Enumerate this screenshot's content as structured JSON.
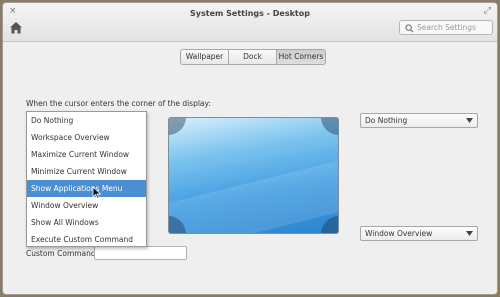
{
  "window": {
    "title": "System Settings - Desktop",
    "close_glyph": "×",
    "maximize_glyph": "⤢"
  },
  "header": {
    "home_icon": "home-icon",
    "search": {
      "placeholder": "Search Settings",
      "value": "",
      "icon": "search-icon"
    }
  },
  "tabs": [
    {
      "label": "Wallpaper",
      "active": false
    },
    {
      "label": "Dock",
      "active": false
    },
    {
      "label": "Hot Corners",
      "active": true
    }
  ],
  "hot_corners": {
    "instruction": "When the cursor enters the corner of the display:",
    "menu_items": [
      "Do Nothing",
      "Workspace Overview",
      "Maximize Current Window",
      "Minimize Current Window",
      "Show Applications Menu",
      "Window Overview",
      "Show All Windows",
      "Execute Custom Command"
    ],
    "selected_index": 4,
    "top_right_value": "Do Nothing",
    "bottom_right_value": "Window Overview",
    "custom_command_label": "Custom Command:",
    "custom_command_value": ""
  },
  "colors": {
    "selection": "#4a8fd3",
    "window_bg": "#efefef",
    "preview_blue": "#3f9be0"
  }
}
